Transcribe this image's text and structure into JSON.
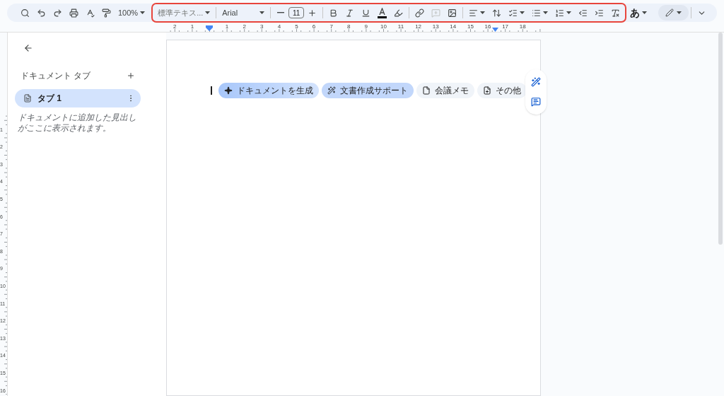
{
  "toolbar": {
    "zoom": "100%",
    "paragraph_style": "標準テキス...",
    "font": "Arial",
    "font_size": "11",
    "comment_disabled": true,
    "input_tool": "あ"
  },
  "ruler": {
    "left_labels": [
      "2",
      "1"
    ],
    "labels": [
      "1",
      "2",
      "3",
      "4",
      "5",
      "6",
      "7",
      "8",
      "9",
      "10",
      "11",
      "12",
      "13",
      "14",
      "15",
      "16",
      "17",
      "18"
    ]
  },
  "vertical_ruler": {
    "labels": [
      "1",
      "2",
      "3",
      "4",
      "5",
      "6",
      "7",
      "8",
      "9",
      "10",
      "11",
      "12",
      "13",
      "14",
      "15",
      "16"
    ]
  },
  "sidebar": {
    "title": "ドキュメント タブ",
    "tabs": [
      {
        "label": "タブ 1",
        "selected": true
      }
    ],
    "hint": "ドキュメントに追加した見出しがここに表示されます。"
  },
  "chips": [
    {
      "label": "ドキュメントを生成",
      "kind": "generate"
    },
    {
      "label": "文書作成サポート",
      "kind": "assist"
    },
    {
      "label": "会議メモ",
      "kind": "notes"
    },
    {
      "label": "その他",
      "kind": "more"
    }
  ]
}
